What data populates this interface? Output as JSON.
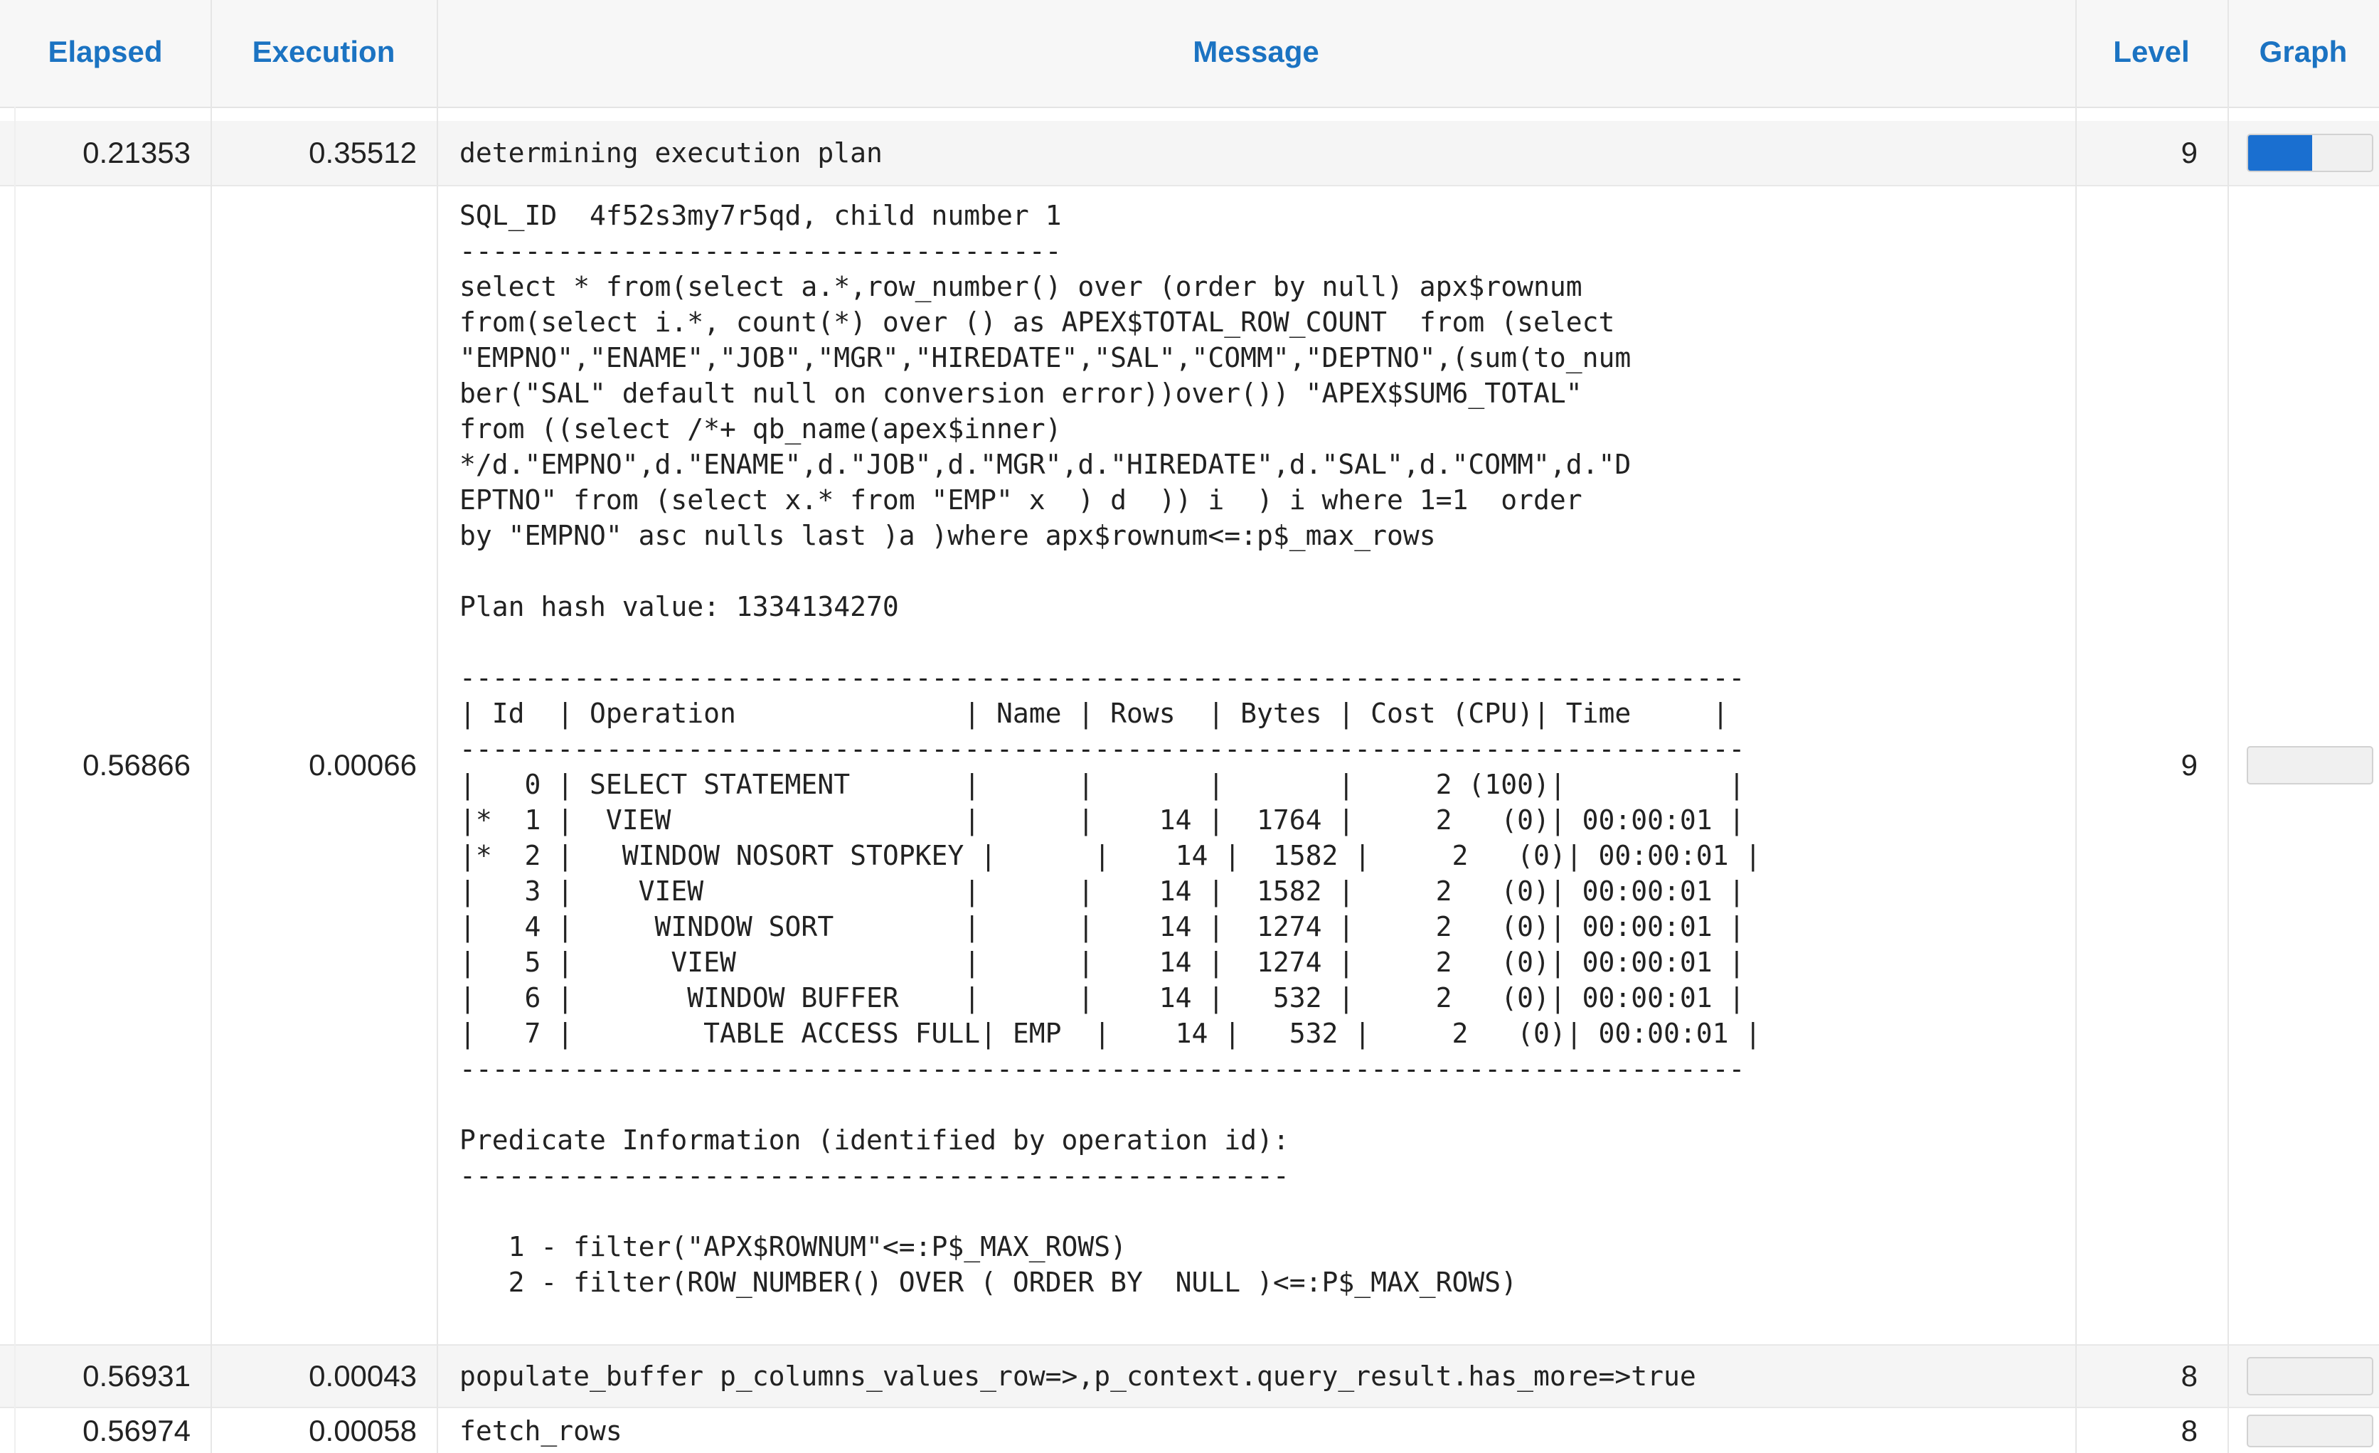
{
  "columns": {
    "elapsed": "Elapsed",
    "execution": "Execution",
    "message": "Message",
    "level": "Level",
    "graph": "Graph"
  },
  "colors": {
    "header_text": "#1b73c2",
    "bar_fill": "#1a6fd0",
    "bar_track": "#f0f0f0"
  },
  "rows": [
    {
      "elapsed": "0.21353",
      "execution": "0.35512",
      "message": "determining execution plan",
      "level": "9",
      "graph_fraction": 0.52
    },
    {
      "elapsed": "0.56866",
      "execution": "0.00066",
      "message": "SQL_ID  4f52s3my7r5qd, child number 1\n-------------------------------------\nselect * from(select a.*,row_number() over (order by null) apx$rownum\nfrom(select i.*, count(*) over () as APEX$TOTAL_ROW_COUNT  from (select\n\"EMPNO\",\"ENAME\",\"JOB\",\"MGR\",\"HIREDATE\",\"SAL\",\"COMM\",\"DEPTNO\",(sum(to_num\nber(\"SAL\" default null on conversion error))over()) \"APEX$SUM6_TOTAL\"\nfrom ((select /*+ qb_name(apex$inner)\n*/d.\"EMPNO\",d.\"ENAME\",d.\"JOB\",d.\"MGR\",d.\"HIREDATE\",d.\"SAL\",d.\"COMM\",d.\"D\nEPTNO\" from (select x.* from \"EMP\" x  ) d  )) i  ) i where 1=1  order\nby \"EMPNO\" asc nulls last )a )where apx$rownum<=:p$_max_rows\n\nPlan hash value: 1334134270\n\n-------------------------------------------------------------------------------\n| Id  | Operation              | Name | Rows  | Bytes | Cost (CPU)| Time     |\n-------------------------------------------------------------------------------\n|   0 | SELECT STATEMENT       |      |       |       |     2 (100)|          |\n|*  1 |  VIEW                  |      |    14 |  1764 |     2   (0)| 00:00:01 |\n|*  2 |   WINDOW NOSORT STOPKEY |      |    14 |  1582 |     2   (0)| 00:00:01 |\n|   3 |    VIEW                |      |    14 |  1582 |     2   (0)| 00:00:01 |\n|   4 |     WINDOW SORT        |      |    14 |  1274 |     2   (0)| 00:00:01 |\n|   5 |      VIEW              |      |    14 |  1274 |     2   (0)| 00:00:01 |\n|   6 |       WINDOW BUFFER    |      |    14 |   532 |     2   (0)| 00:00:01 |\n|   7 |        TABLE ACCESS FULL| EMP  |    14 |   532 |     2   (0)| 00:00:01 |\n-------------------------------------------------------------------------------\n\nPredicate Information (identified by operation id):\n---------------------------------------------------\n\n   1 - filter(\"APX$ROWNUM\"<=:P$_MAX_ROWS)\n   2 - filter(ROW_NUMBER() OVER ( ORDER BY  NULL )<=:P$_MAX_ROWS)",
      "level": "9",
      "graph_fraction": 0.0
    },
    {
      "elapsed": "0.56931",
      "execution": "0.00043",
      "message": "populate_buffer p_columns_values_row=>,p_context.query_result.has_more=>true",
      "level": "8",
      "graph_fraction": 0.0
    },
    {
      "elapsed": "0.56974",
      "execution": "0.00058",
      "message": "fetch_rows",
      "level": "8",
      "graph_fraction": 0.0
    }
  ]
}
